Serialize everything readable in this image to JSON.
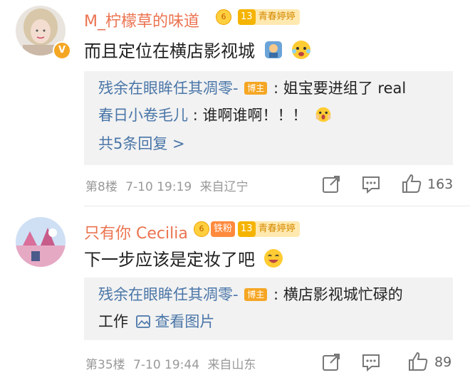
{
  "comments": [
    {
      "username": "M_柠檬草的味道",
      "level_badge": "6",
      "badge_num": "13",
      "badge_label": "青春婷婷",
      "text": "而且定位在横店影视城",
      "reply": {
        "line1_user": "残余在眼眸任其凋零-",
        "line1_host": "博主",
        "line1_text": ": 姐宝要进组了 real",
        "line2_user": "春日小卷毛儿",
        "line2_text": ": 谁啊谁啊！！！",
        "more_link": "共5条回复 >"
      },
      "floor": "第8楼",
      "date": "7-10 19:19",
      "location": "来自辽宁",
      "likes": "163"
    },
    {
      "username": "只有你 Cecilia",
      "level_badge": "6",
      "fan_badge": "铁粉",
      "badge_num": "13",
      "badge_label": "青春婷婷",
      "text": "下一步应该是定妆了吧",
      "reply": {
        "line1_user": "残余在眼眸任其凋零-",
        "line1_host": "博主",
        "line1_text": ": 横店影视城忙碌的",
        "line2_text": "工作",
        "view_pic": "查看图片"
      },
      "floor": "第35楼",
      "date": "7-10 19:44",
      "location": "来自山东",
      "likes": "89"
    }
  ],
  "icons": [
    "verified-icon",
    "share-icon",
    "comment-icon",
    "like-icon",
    "image-icon"
  ]
}
